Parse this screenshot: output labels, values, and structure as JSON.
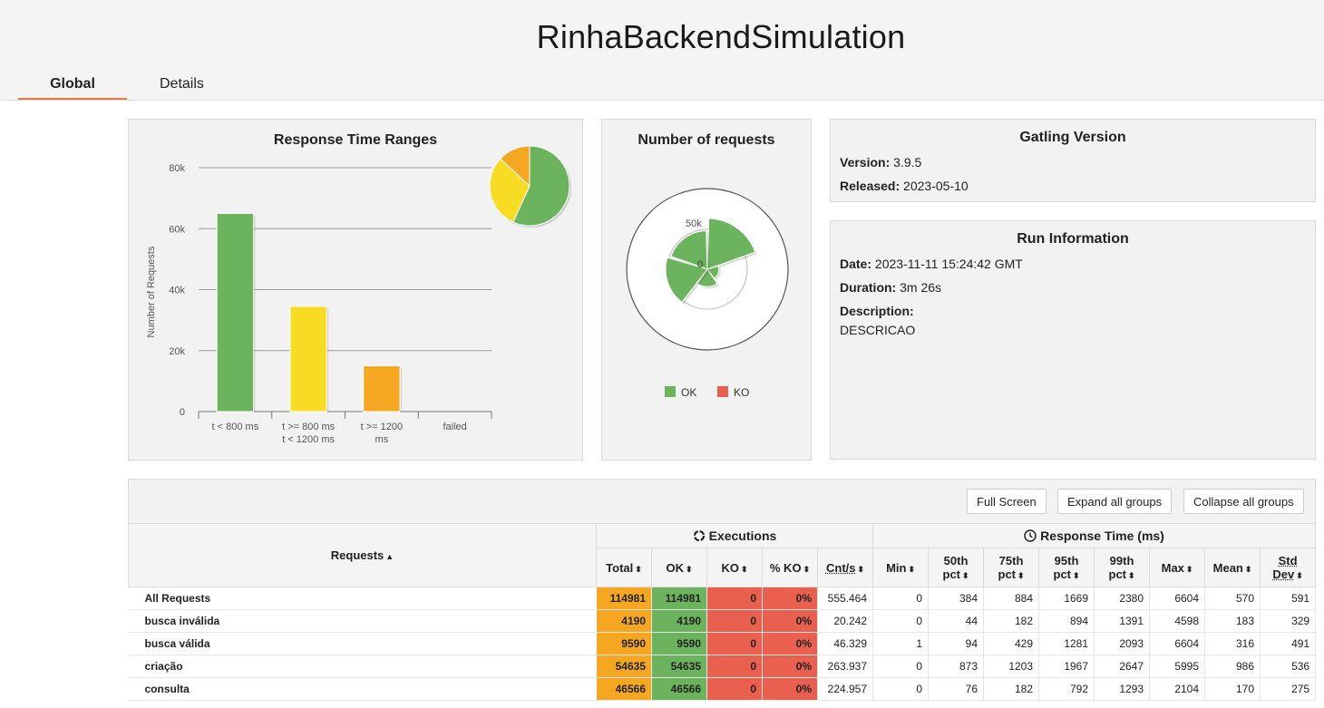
{
  "page": {
    "title": "RinhaBackendSimulation"
  },
  "tabs": [
    {
      "label": "Global"
    },
    {
      "label": "Details"
    }
  ],
  "response_time_chart": {
    "title": "Response Time Ranges",
    "ylabel": "Number of Requests",
    "y_ticks": [
      "80k",
      "60k",
      "40k",
      "20k",
      "0"
    ],
    "categories": [
      [
        "t < 800 ms"
      ],
      [
        "t >= 800 ms",
        "t < 1200 ms"
      ],
      [
        "t >= 1200",
        "ms"
      ],
      [
        "failed"
      ]
    ],
    "colors": [
      "#6cb35d",
      "#f8dc24",
      "#f6a721",
      "#e9604f"
    ]
  },
  "requests_chart": {
    "title": "Number of requests",
    "ticks": [
      "50k",
      "0"
    ],
    "legend": [
      {
        "label": "OK",
        "color": "#6cb35d"
      },
      {
        "label": "KO",
        "color": "#e9604f"
      }
    ]
  },
  "chart_data": [
    {
      "type": "bar",
      "categories": [
        "t < 800 ms",
        "t >= 800 ms t < 1200 ms",
        "t >= 1200 ms",
        "failed"
      ],
      "values": [
        65000,
        34500,
        15000,
        0
      ],
      "title": "Response Time Ranges",
      "xlabel": "",
      "ylabel": "Number of Requests",
      "ylim": [
        0,
        80000
      ],
      "grid": true,
      "legend": "none"
    },
    {
      "type": "pie",
      "categories": [
        "t < 800 ms",
        "t >= 800 ms t < 1200 ms",
        "t >= 1200 ms",
        "failed"
      ],
      "values": [
        65000,
        34500,
        15000,
        0
      ]
    },
    {
      "type": "area",
      "title": "Number of requests",
      "categories": [
        "All Requests",
        "busca inválida",
        "busca válida",
        "criação",
        "consulta"
      ],
      "series": [
        {
          "name": "OK",
          "values": [
            114981,
            4190,
            9590,
            54635,
            46566
          ]
        },
        {
          "name": "KO",
          "values": [
            0,
            0,
            0,
            0,
            0
          ]
        }
      ],
      "ylim": [
        0,
        50000
      ],
      "legend": "bottom"
    }
  ],
  "gatling": {
    "title": "Gatling Version",
    "version_label": "Version:",
    "version": "3.9.5",
    "released_label": "Released:",
    "released": "2023-05-10"
  },
  "run": {
    "title": "Run Information",
    "date_label": "Date:",
    "date": "2023-11-11 15:24:42 GMT",
    "duration_label": "Duration:",
    "duration": "3m 26s",
    "description_label": "Description:",
    "description": "DESCRICAO"
  },
  "buttons": {
    "full_screen": "Full Screen",
    "expand": "Expand all groups",
    "collapse": "Collapse all groups"
  },
  "table": {
    "requests_header": "Requests",
    "executions_header": "Executions",
    "response_time_header": "Response Time (ms)",
    "columns": [
      "Total",
      "OK",
      "KO",
      "% KO",
      "Cnt/s",
      "Min",
      "50th pct",
      "75th pct",
      "95th pct",
      "99th pct",
      "Max",
      "Mean",
      "Std Dev"
    ],
    "rows": [
      {
        "name": "All Requests",
        "values": [
          "114981",
          "114981",
          "0",
          "0%",
          "555.464",
          "0",
          "384",
          "884",
          "1669",
          "2380",
          "6604",
          "570",
          "591"
        ]
      },
      {
        "name": "busca inválida",
        "values": [
          "4190",
          "4190",
          "0",
          "0%",
          "20.242",
          "0",
          "44",
          "182",
          "894",
          "1391",
          "4598",
          "183",
          "329"
        ]
      },
      {
        "name": "busca válida",
        "values": [
          "9590",
          "9590",
          "0",
          "0%",
          "46.329",
          "1",
          "94",
          "429",
          "1281",
          "2093",
          "6604",
          "316",
          "491"
        ]
      },
      {
        "name": "criação",
        "values": [
          "54635",
          "54635",
          "0",
          "0%",
          "263.937",
          "0",
          "873",
          "1203",
          "1967",
          "2647",
          "5995",
          "986",
          "536"
        ]
      },
      {
        "name": "consulta",
        "values": [
          "46566",
          "46566",
          "0",
          "0%",
          "224.957",
          "0",
          "76",
          "182",
          "792",
          "1293",
          "2104",
          "170",
          "275"
        ]
      }
    ]
  }
}
